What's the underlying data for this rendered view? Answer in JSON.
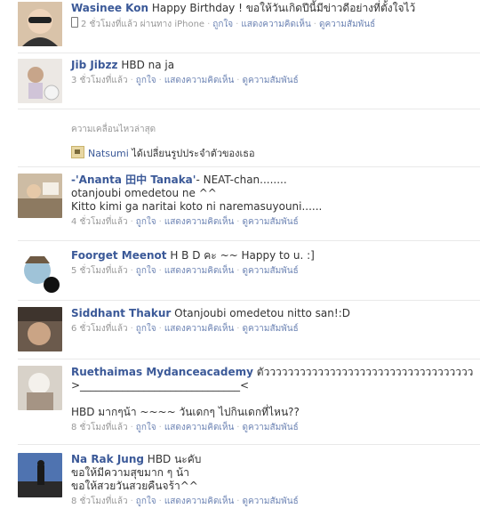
{
  "posts": [
    {
      "author": "Wasinee Kon",
      "message": "Happy Birthday ! ขอให้วันเกิดปีนี้มีข่าวดีอย่างที่ตั้งใจไว้",
      "time": "2 ชั่วโมงที่แล้ว ผ่านทาง iPhone",
      "like": "ถูกใจ",
      "comment": "แสดงความคิดเห็น",
      "relationship": "ดูความสัมพันธ์",
      "avatar_color": "#c9a88a"
    },
    {
      "author": "Jib Jibzz",
      "message": "HBD na ja",
      "time": "3 ชั่วโมงที่แล้ว",
      "like": "ถูกใจ",
      "comment": "แสดงความคิดเห็น",
      "relationship": "ดูความสัมพันธ์",
      "avatar_color": "#d8d2cc"
    },
    {
      "author": "-'Ananta 田中 Tanaka'",
      "message": "- NEAT-chan........",
      "message2": "otanjoubi omedetou ne ^^",
      "message3": "Kitto kimi ga naritai koto ni naremasuyouni......",
      "time": "4 ชั่วโมงที่แล้ว",
      "like": "ถูกใจ",
      "comment": "แสดงความคิดเห็น",
      "relationship": "ดูความสัมพันธ์",
      "avatar_color": "#b39a7c"
    },
    {
      "author": "Foorget Meenot",
      "message": "H B D คะ ~~ Happy to u. :]",
      "time": "5 ชั่วโมงที่แล้ว",
      "like": "ถูกใจ",
      "comment": "แสดงความคิดเห็น",
      "relationship": "ดูความสัมพันธ์",
      "avatar_color": "#9fc3d8"
    },
    {
      "author": "Siddhant Thakur",
      "message": "Otanjoubi omedetou nitto san!:D",
      "time": "6 ชั่วโมงที่แล้ว",
      "like": "ถูกใจ",
      "comment": "แสดงความคิดเห็น",
      "relationship": "ดูความสัมพันธ์",
      "avatar_color": "#8e7a68"
    },
    {
      "author": "Ruethaimas Mydanceacademy",
      "message": "ตัววววววววววววววววววววววววววววววววววว",
      "message2": ">______________________________<",
      "message3": "HBD มากๆน้า ~~~~ วันเดกๆ ไปกินเดกที่ไหน??",
      "time": "8 ชั่วโมงที่แล้ว",
      "like": "ถูกใจ",
      "comment": "แสดงความคิดเห็น",
      "relationship": "ดูความสัมพันธ์",
      "avatar_color": "#b8b0a6"
    },
    {
      "author": "Na Rak Jung",
      "message": "HBD นะคับ",
      "message2": "ขอให้มีความสุขมาก ๆ น้า",
      "message3": "ขอให้สวยวันสวยคืนจร้า^^",
      "time": "8 ชั่วโมงที่แล้ว",
      "like": "ถูกใจ",
      "comment": "แสดงความคิดเห็น",
      "relationship": "ดูความสัมพันธ์",
      "avatar_color": "#5d7bb0"
    }
  ],
  "recent": {
    "title": "ความเคลื่อนไหวล่าสุด",
    "author": "Natsumi",
    "text": "ได้เปลี่ยนรูปประจำตัวของเธอ"
  }
}
